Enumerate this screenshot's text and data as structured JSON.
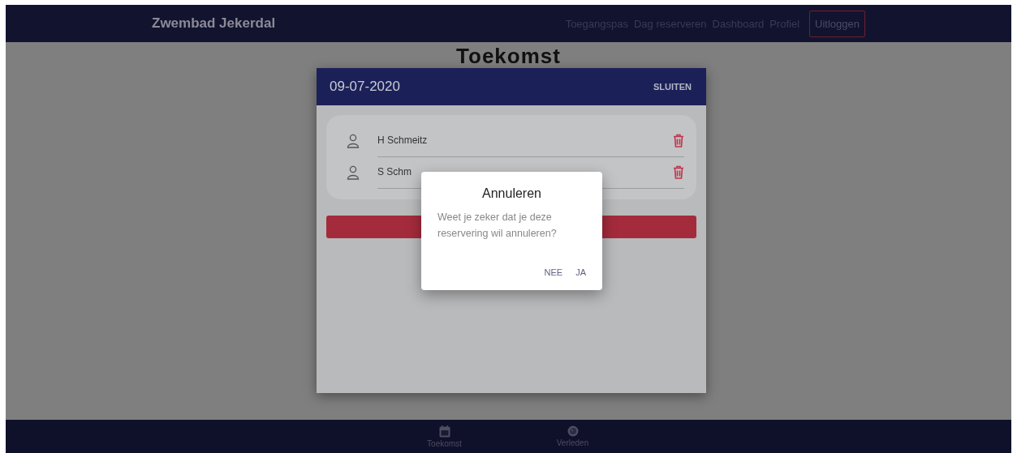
{
  "navbar": {
    "brand": "Zwembad Jekerdal",
    "links": [
      {
        "label": "Toegangspas"
      },
      {
        "label": "Dag reserveren"
      },
      {
        "label": "Dashboard"
      },
      {
        "label": "Profiel"
      }
    ],
    "logout": "Uitloggen"
  },
  "page": {
    "title": "Toekomst"
  },
  "date_modal": {
    "title": "09-07-2020",
    "close": "SLUITEN",
    "guests": [
      {
        "name": "H Schmeitz"
      },
      {
        "name": "S Schm"
      }
    ]
  },
  "confirm_dialog": {
    "title": "Annuleren",
    "message": "Weet je zeker dat je deze reservering wil annuleren?",
    "buttons": [
      "NEE",
      "JA"
    ]
  },
  "bottom_nav": [
    {
      "kind": "calendar",
      "label": "Toekomst"
    },
    {
      "kind": "clock",
      "label": "Verleden"
    }
  ]
}
